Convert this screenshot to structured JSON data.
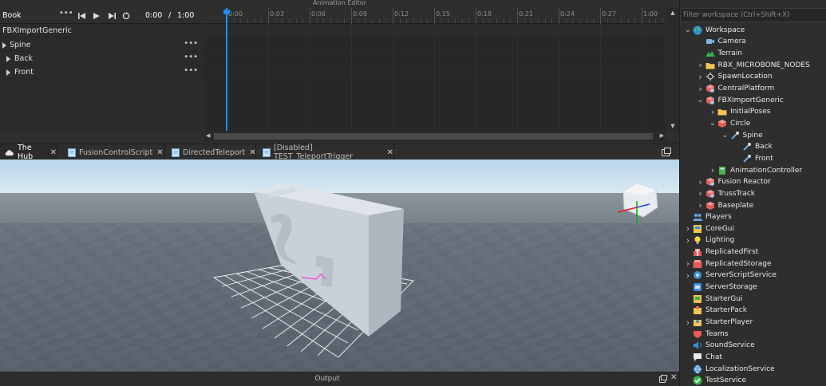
{
  "animation_editor": {
    "title": "Animation Editor",
    "rig_name": "Book",
    "current_time": "0:00",
    "separator": "/",
    "total_time": "1:00",
    "root_track": "FBXImportGeneric",
    "tracks": [
      "Spine",
      "Back",
      "Front"
    ],
    "timeline_labels": [
      "0:00",
      "0:03",
      "0:06",
      "0:09",
      "0:12",
      "0:15",
      "0:18",
      "0:21",
      "0:24",
      "0:27",
      "1:00"
    ],
    "playhead_color": "#1e90ff"
  },
  "tabs": [
    {
      "label": "The Hub",
      "icon": "cloud-icon"
    },
    {
      "label": "FusionControlScript",
      "icon": "script-icon"
    },
    {
      "label": "DirectedTeleport",
      "icon": "script-icon"
    },
    {
      "label": "[Disabled] TEST_TeleportTrigger",
      "icon": "script-icon"
    }
  ],
  "output": {
    "title": "Output"
  },
  "explorer": {
    "filter_placeholder": "Filter workspace (Ctrl+Shift+X)",
    "items": [
      {
        "label": "Workspace",
        "icon": "globe-icon",
        "depth": 0,
        "toggle": "expanded"
      },
      {
        "label": "Camera",
        "icon": "camera-icon",
        "depth": 1,
        "toggle": "none"
      },
      {
        "label": "Terrain",
        "icon": "terrain-icon",
        "depth": 1,
        "toggle": "none"
      },
      {
        "label": "RBX_MICROBONE_NODES",
        "icon": "folder-icon",
        "depth": 1,
        "toggle": "collapsed"
      },
      {
        "label": "SpawnLocation",
        "icon": "spawn-icon",
        "depth": 1,
        "toggle": "collapsed"
      },
      {
        "label": "CentralPlatform",
        "icon": "model-icon",
        "depth": 1,
        "toggle": "collapsed"
      },
      {
        "label": "FBXImportGeneric",
        "icon": "model-icon",
        "depth": 1,
        "toggle": "expanded"
      },
      {
        "label": "InitialPoses",
        "icon": "folder-icon",
        "depth": 2,
        "toggle": "collapsed"
      },
      {
        "label": "Circle",
        "icon": "part-icon",
        "depth": 2,
        "toggle": "expanded"
      },
      {
        "label": "Spine",
        "icon": "bone-icon",
        "depth": 3,
        "toggle": "expanded"
      },
      {
        "label": "Back",
        "icon": "bone-icon",
        "depth": 4,
        "toggle": "none"
      },
      {
        "label": "Front",
        "icon": "bone-icon",
        "depth": 4,
        "toggle": "none"
      },
      {
        "label": "AnimationController",
        "icon": "animation-controller-icon",
        "depth": 2,
        "toggle": "collapsed"
      },
      {
        "label": "Fusion Reactor",
        "icon": "model-icon",
        "depth": 1,
        "toggle": "collapsed"
      },
      {
        "label": "TrussTrack",
        "icon": "model-icon",
        "depth": 1,
        "toggle": "collapsed"
      },
      {
        "label": "Baseplate",
        "icon": "part-icon",
        "depth": 1,
        "toggle": "collapsed"
      },
      {
        "label": "Players",
        "icon": "players-icon",
        "depth": 0,
        "toggle": "none"
      },
      {
        "label": "CoreGui",
        "icon": "coregui-icon",
        "depth": 0,
        "toggle": "collapsed"
      },
      {
        "label": "Lighting",
        "icon": "lighting-icon",
        "depth": 0,
        "toggle": "collapsed"
      },
      {
        "label": "ReplicatedFirst",
        "icon": "replicated-first-icon",
        "depth": 0,
        "toggle": "none"
      },
      {
        "label": "ReplicatedStorage",
        "icon": "replicated-storage-icon",
        "depth": 0,
        "toggle": "collapsed"
      },
      {
        "label": "ServerScriptService",
        "icon": "server-script-icon",
        "depth": 0,
        "toggle": "collapsed"
      },
      {
        "label": "ServerStorage",
        "icon": "server-storage-icon",
        "depth": 0,
        "toggle": "none"
      },
      {
        "label": "StarterGui",
        "icon": "starter-gui-icon",
        "depth": 0,
        "toggle": "none"
      },
      {
        "label": "StarterPack",
        "icon": "starter-pack-icon",
        "depth": 0,
        "toggle": "none"
      },
      {
        "label": "StarterPlayer",
        "icon": "starter-player-icon",
        "depth": 0,
        "toggle": "collapsed"
      },
      {
        "label": "Teams",
        "icon": "teams-icon",
        "depth": 0,
        "toggle": "none"
      },
      {
        "label": "SoundService",
        "icon": "sound-icon",
        "depth": 0,
        "toggle": "none"
      },
      {
        "label": "Chat",
        "icon": "chat-icon",
        "depth": 0,
        "toggle": "none"
      },
      {
        "label": "LocalizationService",
        "icon": "localization-icon",
        "depth": 0,
        "toggle": "none"
      },
      {
        "label": "TestService",
        "icon": "test-icon",
        "depth": 0,
        "toggle": "none"
      }
    ]
  },
  "colors": {
    "panel_bg": "#2e2e2e",
    "sky_top": "#b9d7ea",
    "sky_bottom": "#e3eef5",
    "baseplate": "#5a6470",
    "accent": "#1e90ff"
  }
}
